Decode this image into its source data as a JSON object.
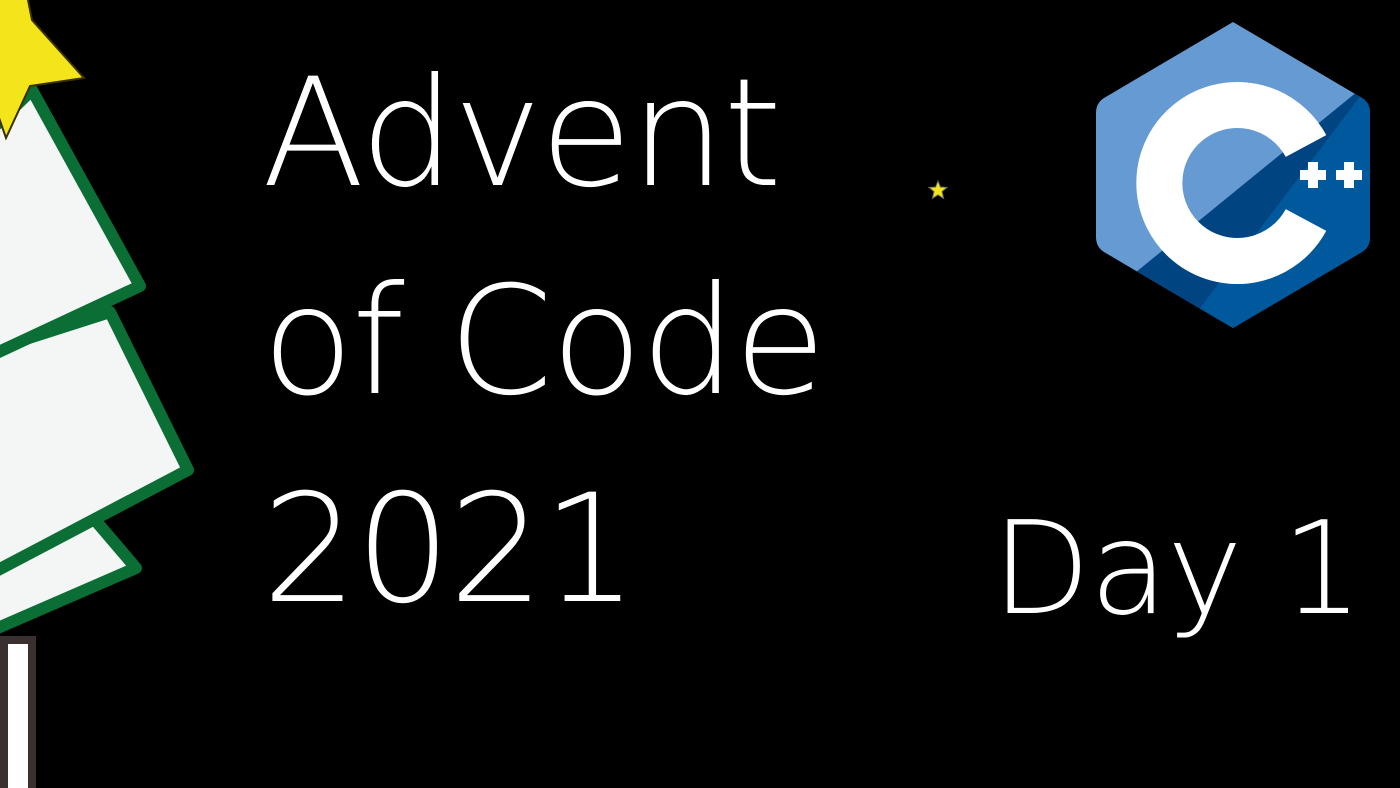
{
  "title": {
    "line1": "Advent",
    "line2": "of Code",
    "line3": "2021"
  },
  "day_label": "Day 1",
  "logo": {
    "name": "cpp-logo",
    "text_letter": "C",
    "text_plus": "++"
  },
  "icons": {
    "tree": "christmas-tree-icon",
    "tree_star": "star-icon",
    "sparkle": "star-icon"
  },
  "colors": {
    "background": "#000000",
    "text": "#ffffff",
    "tree_fill": "#f4f6f6",
    "tree_border": "#0b6e35",
    "trunk": "#3a3030",
    "star": "#f4e51a",
    "logo_light": "#659ad2",
    "logo_mid": "#00599c",
    "logo_dark": "#004482"
  }
}
